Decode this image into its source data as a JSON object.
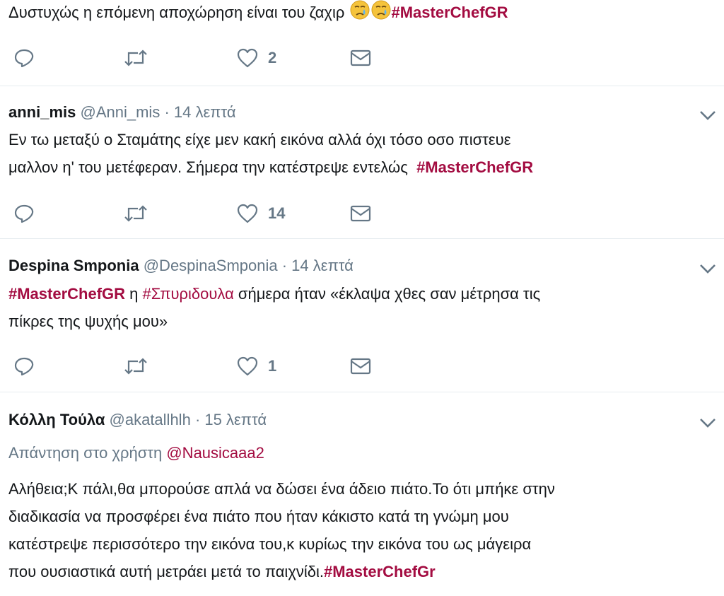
{
  "tweets": [
    {
      "text_plain": "Δυστυχώς η επόμενη αποχώρηση είναι του ζαχιρ ",
      "hashtag": "#MasterChefGR",
      "likes": "2"
    },
    {
      "name": "anni_mis",
      "handle": "@Anni_mis",
      "time": "· 14 λεπτά",
      "line1": "Εν τω μεταξύ ο Σταμάτης είχε μεν κακή εικόνα αλλά όχι τόσο οσο πιστευε",
      "line2": "μαλλον η' του μετέφεραν. Σήμερα την κατέστρεψε εντελώς  ",
      "hashtag": "#MasterChefGR",
      "likes": "14"
    },
    {
      "name": "Despina Smponia",
      "handle": "@DespinaSmponia",
      "time": "· 14 λεπτά",
      "hashtag1": "#MasterChefGR",
      "mid": " η ",
      "hashtag2": "#Σπυριδουλα",
      "line1_rest": " σήμερα ήταν «έκλαψα χθες σαν μέτρησα τις",
      "line2": "πίκρες της ψυχής μου»",
      "likes": "1"
    },
    {
      "name": "Κόλλη Τούλα",
      "handle": "@akatallhlh",
      "time": "· 15 λεπτά",
      "reply_label": "Απάντηση στο χρήστη ",
      "reply_mention": "@Nausicaaa2",
      "line1": "Αλήθεια;Κ πάλι,θα μπορούσε απλά να δώσει ένα άδειο πιάτο.Το ότι μπήκε στην",
      "line2": "διαδικασία να προσφέρει ένα πιάτο που ήταν κάκιστο κατά τη γνώμη μου",
      "line3": "κατέστρεψε περισσότερο την εικόνα του,κ κυρίως την εικόνα του ως μάγειρα",
      "line4": "που ουσιαστικά αυτή μετράει μετά το παιχνίδι.",
      "hashtag": "#MasterChefGr"
    }
  ],
  "colors": {
    "hashtag": "#a30c41",
    "meta": "#657786",
    "separator": "#e6ecf0"
  },
  "icons": [
    "reply-icon",
    "retweet-icon",
    "like-icon",
    "dm-icon",
    "chevron-down-icon",
    "crying-face-emoji"
  ]
}
